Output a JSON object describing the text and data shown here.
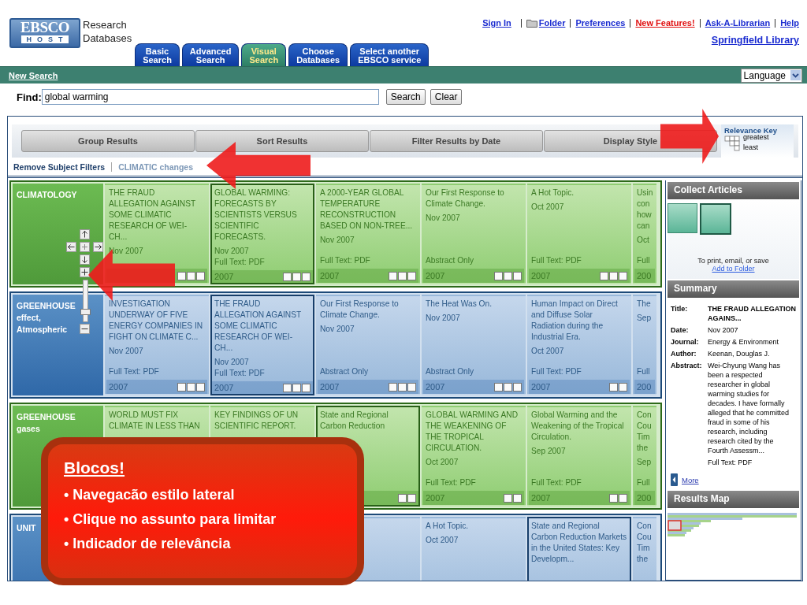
{
  "logo": {
    "top": "EBSCO",
    "bottom": "HOST",
    "line1": "Research",
    "line2": "Databases"
  },
  "tabs": [
    {
      "label": "Basic\nSearch",
      "selected": false
    },
    {
      "label": "Advanced\nSearch",
      "selected": false
    },
    {
      "label": "Visual\nSearch",
      "selected": true
    },
    {
      "label": "Choose\nDatabases",
      "selected": false
    },
    {
      "label": "Select another\nEBSCO service",
      "selected": false
    }
  ],
  "top_links": [
    {
      "label": "Sign In",
      "kind": "plain"
    },
    {
      "label": "Folder",
      "kind": "folder"
    },
    {
      "label": "Preferences",
      "kind": "plain"
    },
    {
      "label": "New Features!",
      "kind": "alert"
    },
    {
      "label": "Ask-A-Librarian",
      "kind": "plain"
    },
    {
      "label": "Help",
      "kind": "plain"
    }
  ],
  "library": "Springfield Library",
  "nav_bar": {
    "new_search": "New Search",
    "language": "Language"
  },
  "find": {
    "label": "Find:",
    "value": "global warming",
    "buttons": [
      "Search",
      "Clear"
    ]
  },
  "toolbar": [
    "Group Results",
    "Sort Results",
    "Filter Results by Date",
    "Display Style"
  ],
  "relevance_key": {
    "title": "Relevance Key",
    "greatest": "greatest",
    "least": "least"
  },
  "filters": {
    "remove": "Remove Subject Filters",
    "active": "CLIMATIC changes"
  },
  "rows": [
    {
      "label": "CLIMATOLOGY",
      "kind": "green",
      "cells": [
        {
          "title": "THE FRAUD ALLEGATION AGAINST SOME CLIMATIC RESEARCH OF WEI-CH...",
          "date": "Nov 2007",
          "kind": "high",
          "selected": false
        },
        {
          "title": "GLOBAL WARMING: FORECASTS BY SCIENTISTS VERSUS SCIENTIFIC FORECASTS.",
          "date": "Nov 2007",
          "access": "Full Text: PDF",
          "year": "2007",
          "kind": "high",
          "selected": true
        },
        {
          "title": "A 2000-YEAR GLOBAL TEMPERATURE RECONSTRUCTION BASED ON NON-TREE...",
          "date": "Nov 2007",
          "access": "Full Text: PDF",
          "year": "2007",
          "kind": "high",
          "selected": false
        },
        {
          "title": "Our First Response to Climate Change.",
          "date": "Nov 2007",
          "access": "Abstract Only",
          "year": "2007",
          "kind": "high",
          "selected": false
        },
        {
          "title": "A Hot Topic.",
          "date": "Oct 2007",
          "access": "Full Text: PDF",
          "year": "2007",
          "kind": "high",
          "selected": false
        },
        {
          "title": "Usin con how can",
          "date": "Oct",
          "access": "Full",
          "year": "200",
          "selected": false
        }
      ]
    },
    {
      "label": "GREENHOUSE effect, Atmospheric",
      "kind": "blue",
      "cells": [
        {
          "title": "INVESTIGATION UNDERWAY OF FIVE ENERGY COMPANIES IN FIGHT ON CLIMATE C...",
          "date": "Nov 2007",
          "access": "Full Text: PDF",
          "year": "2007",
          "kind": "high",
          "selected": false
        },
        {
          "title": "THE FRAUD ALLEGATION AGAINST SOME CLIMATIC RESEARCH OF WEI-CH...",
          "date": "Nov 2007",
          "access": "Full Text: PDF",
          "year": "2007",
          "kind": "high",
          "selected": true
        },
        {
          "title": "Our First Response to Climate Change.",
          "date": "Nov 2007",
          "access": "Abstract Only",
          "year": "2007",
          "kind": "high",
          "selected": false
        },
        {
          "title": "The Heat Was On.",
          "date": "Nov 2007",
          "access": "Abstract Only",
          "year": "2007",
          "kind": "high",
          "selected": false
        },
        {
          "title": "Human Impact on Direct and Diffuse Solar Radiation during the Industrial Era.",
          "date": "Oct 2007",
          "access": "Full Text: PDF",
          "year": "2007",
          "kind": "medium",
          "selected": false
        },
        {
          "title": "The",
          "date": "Sep",
          "access": "Full",
          "year": "200",
          "selected": false
        }
      ]
    },
    {
      "label": "GREENHOUSE gases",
      "kind": "green",
      "cells": [
        {
          "title": "WORLD MUST FIX CLIMATE IN LESS THAN",
          "selected": false
        },
        {
          "title": "KEY FINDINGS OF UN SCIENTIFIC REPORT.",
          "selected": false
        },
        {
          "title": "State and Regional Carbon Reduction",
          "kind": "medium",
          "selected": true
        },
        {
          "title": "GLOBAL WARMING AND THE WEAKENING OF THE TROPICAL CIRCULATION.",
          "date": "Oct 2007",
          "access": "Full Text: PDF",
          "year": "2007",
          "kind": "medium",
          "selected": false
        },
        {
          "title": "Global Warming and the Weakening of the Tropical Circulation.",
          "date": "Sep 2007",
          "access": "Full Text: PDF",
          "year": "2007",
          "kind": "medium",
          "selected": false
        },
        {
          "title": "Con Cou Tim the",
          "date": "Sep",
          "access": "Full",
          "year": "200",
          "selected": false
        }
      ]
    },
    {
      "label": "UNIT",
      "kind": "blue",
      "cells": [
        {},
        {},
        {
          "selected": false
        },
        {
          "title": "A Hot Topic.",
          "date": "Oct 2007",
          "selected": false
        },
        {
          "title": "State and Regional Carbon Reduction Markets in the United States: Key Developm...",
          "selected": true
        },
        {
          "title": "Con Cou Tim the",
          "selected": false
        }
      ]
    }
  ],
  "zoom": {
    "level": 0.15
  },
  "collect": {
    "title": "Collect Articles",
    "hint": "To print, email, or save",
    "link": "Add to Folder"
  },
  "summary": {
    "title": "Summary",
    "fields": [
      {
        "label": "Title:",
        "value": "THE FRAUD ALLEGATION AGAINS...",
        "kind": "bold"
      },
      {
        "label": "Date:",
        "value": "Nov 2007",
        "kind": "plain"
      },
      {
        "label": "Journal:",
        "value": "Energy & Environment",
        "kind": "plain"
      },
      {
        "label": "Author:",
        "value": "Keenan, Douglas J.",
        "kind": "plain"
      },
      {
        "label": "Abstract:",
        "value": "Wei-Chyung Wang has been a respected researcher in global warming studies for decades. I have formally alleged that he committed fraud in some of his research, including research cited by the Fourth Assessm...",
        "kind": "plain"
      }
    ],
    "access": "Full Text: PDF",
    "more": "More"
  },
  "results_map": {
    "title": "Results Map"
  },
  "callout": {
    "title": "Blocos!",
    "bullets": [
      "• Navegacão estilo lateral",
      "• Clique no assunto para limitar",
      "• Indicador de relevância"
    ]
  }
}
